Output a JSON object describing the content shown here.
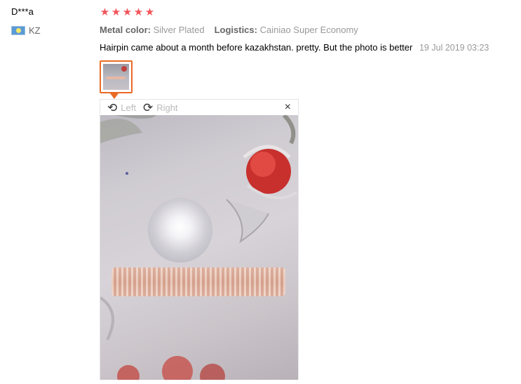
{
  "reviewer": {
    "name": "D***a",
    "country_code": "KZ"
  },
  "rating": {
    "stars": 5
  },
  "attributes": [
    {
      "key": "Metal color:",
      "value": "Silver Plated"
    },
    {
      "key": "Logistics:",
      "value": "Cainiao Super Economy"
    }
  ],
  "review": {
    "text": "Hairpin came about a month before kazakhstan. pretty. But the photo is better",
    "date": "19 Jul 2019 03:23"
  },
  "viewer": {
    "rotate_left_label": "Left",
    "rotate_right_label": "Right",
    "close_label": "×"
  },
  "colors": {
    "star": "#f2555b",
    "thumb_border": "#e96a25"
  }
}
